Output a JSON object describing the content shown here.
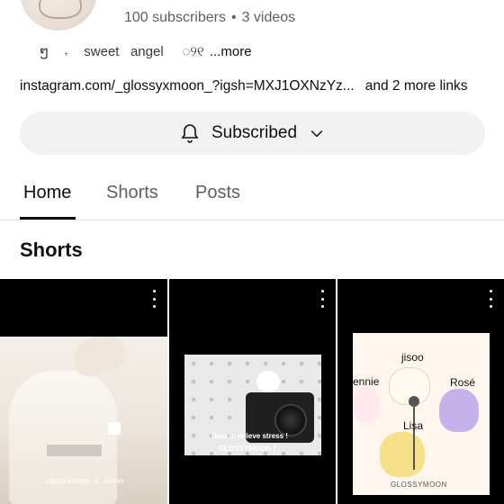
{
  "channel": {
    "subscribers": "100 subscribers",
    "separator": "•",
    "videos": "3 videos",
    "bio_symbol_1": "ໆ",
    "bio_symbol_2": "₊",
    "bio_word_1": "sweet",
    "bio_word_2": "angel",
    "bio_symbol_3": "◌୨୧",
    "more": "...more",
    "link": "instagram.com/_glossyxmoon_?igsh=MXJ1OXNzYz...",
    "more_links": "and 2 more links"
  },
  "subscribe": {
    "label": "Subscribed",
    "icon": "bell-icon"
  },
  "tabs": [
    {
      "label": "Home",
      "active": true
    },
    {
      "label": "Shorts",
      "active": false
    },
    {
      "label": "Posts",
      "active": false
    }
  ],
  "section": {
    "title": "Shorts"
  },
  "shorts": [
    {
      "caption": "",
      "watermark": "GlossyXmoon_X_Jennie"
    },
    {
      "caption": "How to relieve stress !",
      "watermark": "GLOSSYMOON !"
    },
    {
      "labels": [
        "jisoo",
        "ennie",
        "Rosé",
        "Lisa"
      ],
      "watermark": "GLOSSYMOON"
    }
  ],
  "colors": {
    "background": "#ffffff",
    "button_bg": "#f2f2f2",
    "text": "#0f0f0f",
    "muted": "#606060"
  }
}
